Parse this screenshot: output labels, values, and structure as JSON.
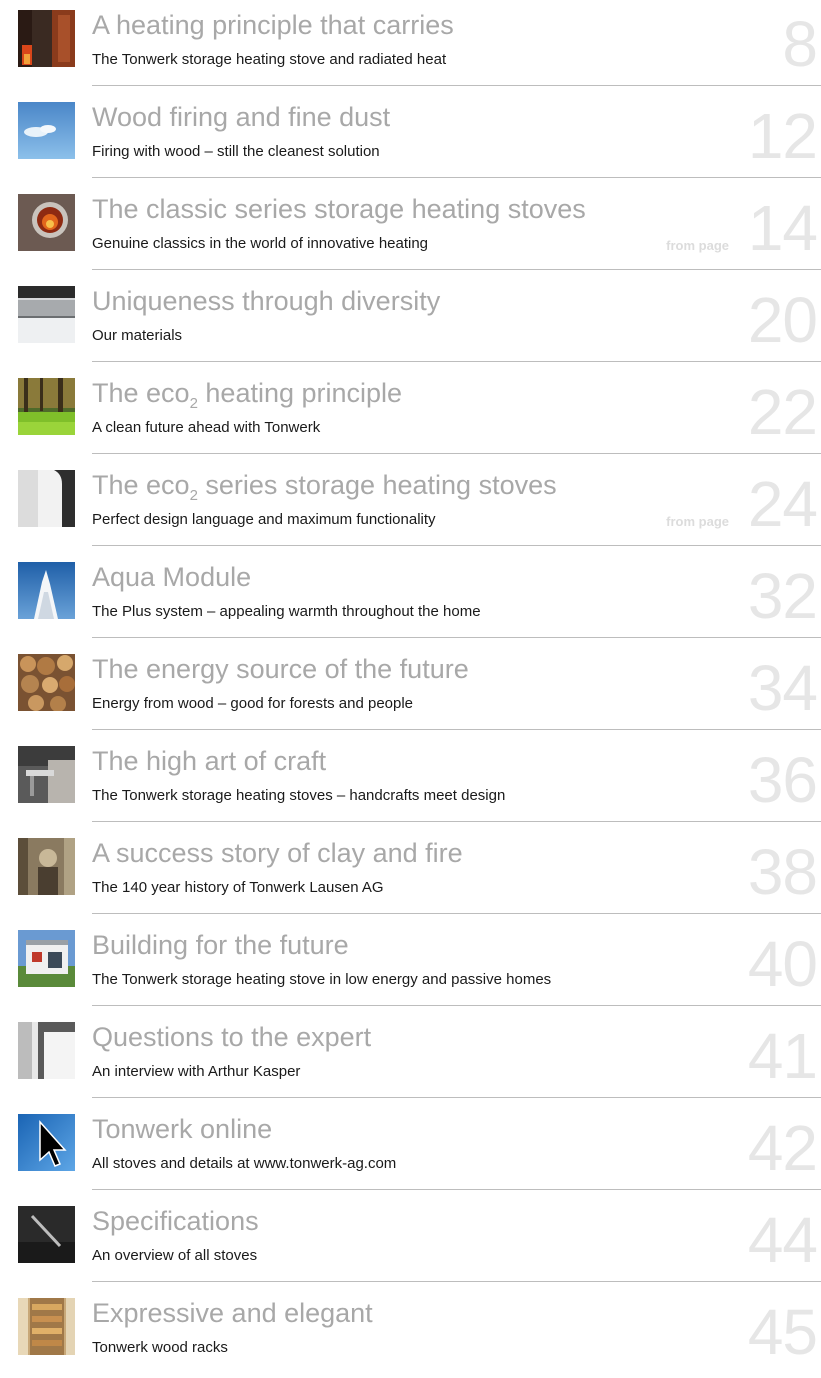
{
  "entries": [
    {
      "title": "A heating principle that carries",
      "subtitle": "The Tonwerk storage heating stove and radiated heat",
      "page": "8",
      "thumb": "fire-stove-thumbnail"
    },
    {
      "title": "Wood firing and fine dust",
      "subtitle": "Firing with wood – still the cleanest solution",
      "page": "12",
      "thumb": "sky-thumbnail"
    },
    {
      "title": "The classic series storage heating stoves",
      "subtitle": "Genuine classics in the world of innovative heating",
      "page": "14",
      "from_page": "from page",
      "thumb": "stove-window-thumbnail"
    },
    {
      "title": "Uniqueness through diversity",
      "subtitle": "Our materials",
      "page": "20",
      "thumb": "materials-thumbnail"
    },
    {
      "title_pre": "The eco",
      "title_sub": "2",
      "title_post": " heating principle",
      "subtitle": "A clean future ahead with Tonwerk",
      "page": "22",
      "thumb": "forest-thumbnail"
    },
    {
      "title_pre": "The eco",
      "title_sub": "2",
      "title_post": " series storage heating stoves",
      "subtitle": "Perfect design language and maximum functionality",
      "page": "24",
      "from_page": "from page",
      "thumb": "stove-corner-thumbnail"
    },
    {
      "title": "Aqua Module",
      "subtitle": "The Plus system – appealing warmth throughout the home",
      "page": "32",
      "thumb": "water-splash-thumbnail"
    },
    {
      "title": "The energy source of the future",
      "subtitle": "Energy from wood – good for forests and people",
      "page": "34",
      "thumb": "firewood-thumbnail"
    },
    {
      "title": "The high art of craft",
      "subtitle": "The Tonwerk storage heating stoves – handcrafts meet design",
      "page": "36",
      "thumb": "craft-thumbnail"
    },
    {
      "title": "A success story of clay and fire",
      "subtitle": "The 140 year history of Tonwerk Lausen AG",
      "page": "38",
      "thumb": "history-thumbnail"
    },
    {
      "title": "Building for the future",
      "subtitle": "The Tonwerk storage heating stove in low energy and passive homes",
      "page": "40",
      "thumb": "house-thumbnail"
    },
    {
      "title": "Questions to the expert",
      "subtitle": "An interview with Arthur Kasper",
      "page": "41",
      "thumb": "expert-thumbnail"
    },
    {
      "title": "Tonwerk online",
      "subtitle": "All stoves and details at www.tonwerk-ag.com",
      "page": "42",
      "thumb": "cursor-thumbnail"
    },
    {
      "title": "Specifications",
      "subtitle": "An overview of all stoves",
      "page": "44",
      "thumb": "specifications-thumbnail"
    },
    {
      "title": "Expressive and elegant",
      "subtitle": "Tonwerk wood racks",
      "page": "45",
      "thumb": "wood-rack-thumbnail"
    }
  ]
}
